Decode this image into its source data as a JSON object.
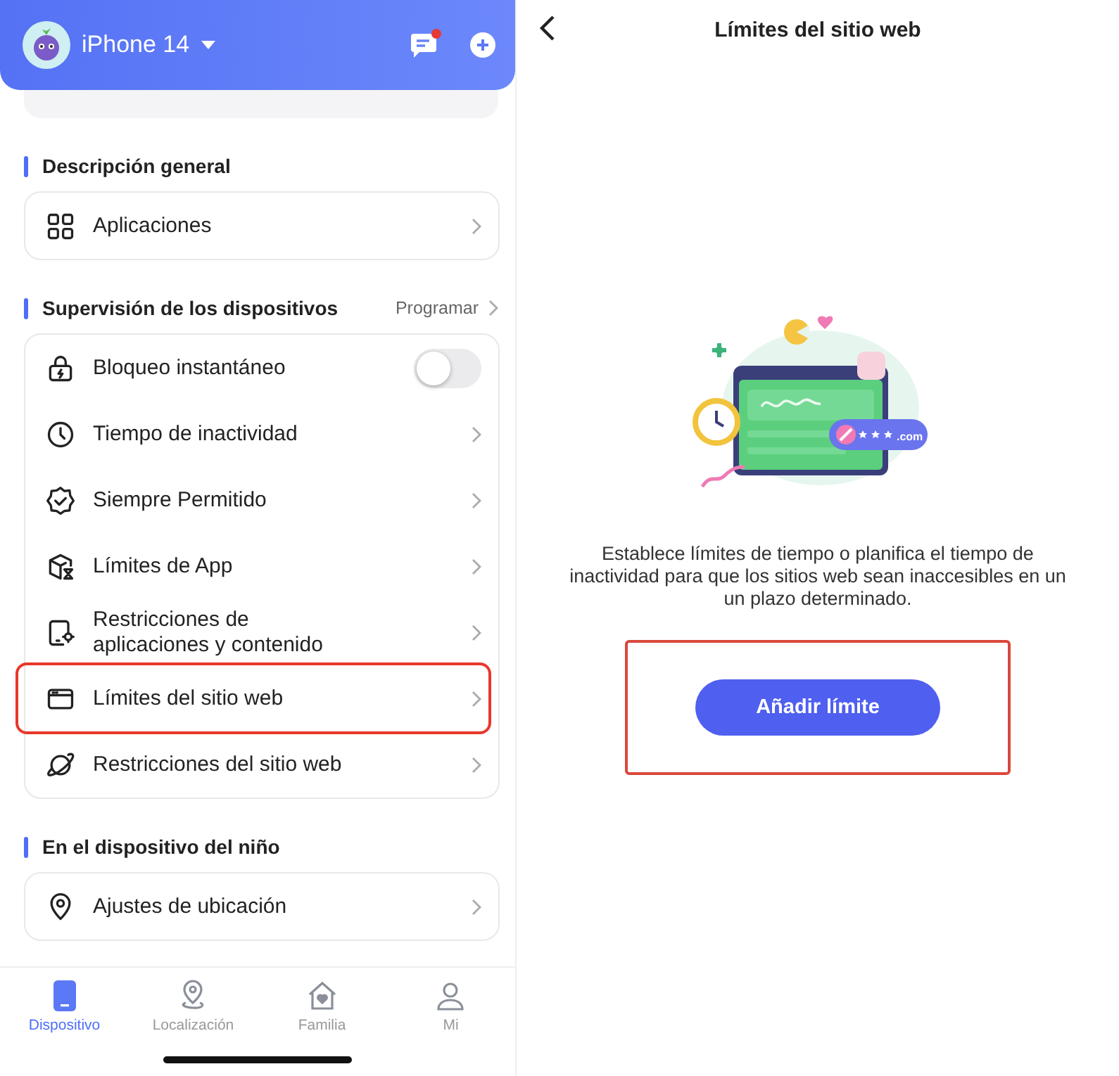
{
  "left": {
    "header": {
      "device": "iPhone 14",
      "unread": true
    },
    "sections": [
      {
        "title": "Descripción general",
        "items": [
          {
            "kind": "link",
            "label": "Aplicaciones",
            "highlighted": false
          }
        ]
      },
      {
        "title": "Supervisión de los dispositivos",
        "action": "Programar",
        "items": [
          {
            "kind": "toggle",
            "label": "Bloqueo instantáneo",
            "on": false,
            "highlighted": false
          },
          {
            "kind": "link",
            "label": "Tiempo de inactividad",
            "highlighted": false
          },
          {
            "kind": "link",
            "label": "Siempre Permitido",
            "highlighted": false
          },
          {
            "kind": "link",
            "label": "Límites de App",
            "highlighted": false
          },
          {
            "kind": "link",
            "label": "Restricciones de aplicaciones y contenido",
            "highlighted": false
          },
          {
            "kind": "link",
            "label": "Límites del sitio web",
            "highlighted": true
          },
          {
            "kind": "link",
            "label": "Restricciones del sitio web",
            "highlighted": false
          }
        ]
      },
      {
        "title": "En el dispositivo del niño",
        "items": [
          {
            "kind": "link",
            "label": "Ajustes de ubicación",
            "highlighted": false
          }
        ]
      }
    ],
    "tabs": [
      {
        "label": "Dispositivo",
        "selected": true
      },
      {
        "label": "Localización",
        "selected": false
      },
      {
        "label": "Familia",
        "selected": false
      },
      {
        "label": "Mi",
        "selected": false
      }
    ]
  },
  "right": {
    "title": "Límites del sitio web",
    "illustration_badge": ".com",
    "description": "Establece límites de tiempo o planifica el tiempo de inactividad para que los sitios web sean inaccesibles en un un plazo determinado.",
    "button": {
      "label": "Añadir límite",
      "highlighted": true
    }
  }
}
